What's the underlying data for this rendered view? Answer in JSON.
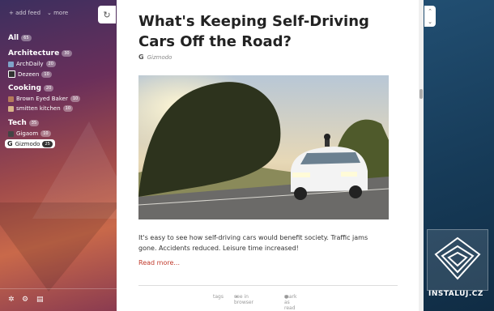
{
  "sidebar": {
    "add_feed": "add feed",
    "more": "more",
    "all": {
      "label": "All",
      "count": "65"
    },
    "categories": [
      {
        "label": "Architecture",
        "count": "30",
        "feeds": [
          {
            "label": "ArchDaily",
            "count": "20"
          },
          {
            "label": "Dezeen",
            "count": "10"
          }
        ]
      },
      {
        "label": "Cooking",
        "count": "20",
        "feeds": [
          {
            "label": "Brown Eyed Baker",
            "count": "10"
          },
          {
            "label": "smitten kitchen",
            "count": "10"
          }
        ]
      },
      {
        "label": "Tech",
        "count": "35",
        "feeds": [
          {
            "label": "Gigaom",
            "count": "10"
          },
          {
            "label": "Gizmodo",
            "count": "25"
          }
        ]
      }
    ]
  },
  "article": {
    "title": "What's Keeping Self-Driving Cars Off the Road?",
    "source": "Gizmodo",
    "source_icon": "G",
    "body": "It's easy to see how self-driving cars would benefit society. Traffic jams gone. Accidents reduced. Leisure time increased!",
    "read_more": "Read more...",
    "footer": {
      "tags": "tags",
      "see_in_browser": "see in browser",
      "mark_as_read": "mark as read"
    }
  },
  "watermark": {
    "text": "INSTALUJ.CZ"
  },
  "colors": {
    "accent": "#c0392b",
    "sidebar_top": "#3c2f5f",
    "sidebar_mid": "#a04b4b",
    "background": "#2b5f86"
  }
}
